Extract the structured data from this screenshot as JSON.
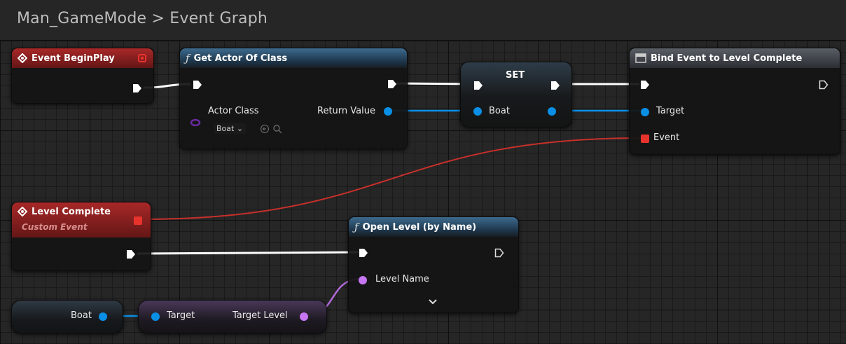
{
  "breadcrumb": {
    "blueprint": "Man_GameMode",
    "separator": ">",
    "graph": "Event Graph"
  },
  "nodes": {
    "begin_play": {
      "title": "Event BeginPlay"
    },
    "get_actor": {
      "title": "Get Actor Of Class",
      "actor_class_label": "Actor Class",
      "class_value": "Boat",
      "return_label": "Return Value"
    },
    "set": {
      "title": "SET",
      "var_label": "Boat"
    },
    "bind": {
      "title": "Bind Event to Level Complete",
      "target_label": "Target",
      "event_label": "Event"
    },
    "level_complete": {
      "title": "Level Complete",
      "subtitle": "Custom Event"
    },
    "open_level": {
      "title": "Open Level (by Name)",
      "level_name_label": "Level Name"
    },
    "boat_var": {
      "label": "Boat"
    },
    "target_level": {
      "target_label": "Target",
      "output_label": "Target Level"
    }
  },
  "colors": {
    "exec": "#ffffff",
    "object": "#0a8fe6",
    "name": "#c676f2",
    "delegate": "#e8332d"
  },
  "icons": [
    "function-icon",
    "event-diamond-icon",
    "delegate-pin-icon",
    "dropdown-chevron-icon",
    "back-arrow-icon",
    "search-icon",
    "bind-node-icon"
  ]
}
